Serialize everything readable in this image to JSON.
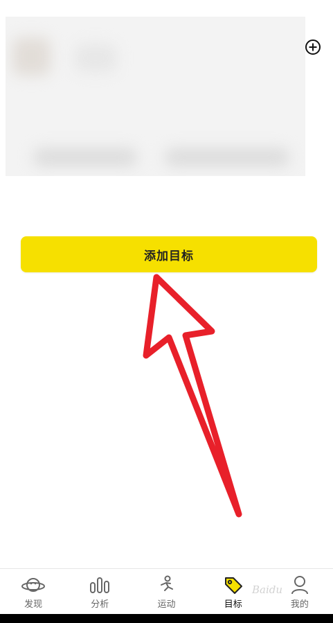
{
  "main": {
    "add_goal_label": "添加目标",
    "add_icon": "plus-circle-icon"
  },
  "tabs": [
    {
      "label": "发现",
      "icon": "planet-icon",
      "active": false
    },
    {
      "label": "分析",
      "icon": "bar-chart-icon",
      "active": false
    },
    {
      "label": "运动",
      "icon": "running-person-icon",
      "active": false
    },
    {
      "label": "目标",
      "icon": "tag-icon",
      "active": true
    },
    {
      "label": "我的",
      "icon": "person-icon",
      "active": false
    }
  ],
  "colors": {
    "accent_yellow": "#f6e000",
    "annotation_red": "#e8202a",
    "text_dark": "#222222",
    "tab_inactive": "#666666"
  },
  "watermark_text": "Baidu"
}
